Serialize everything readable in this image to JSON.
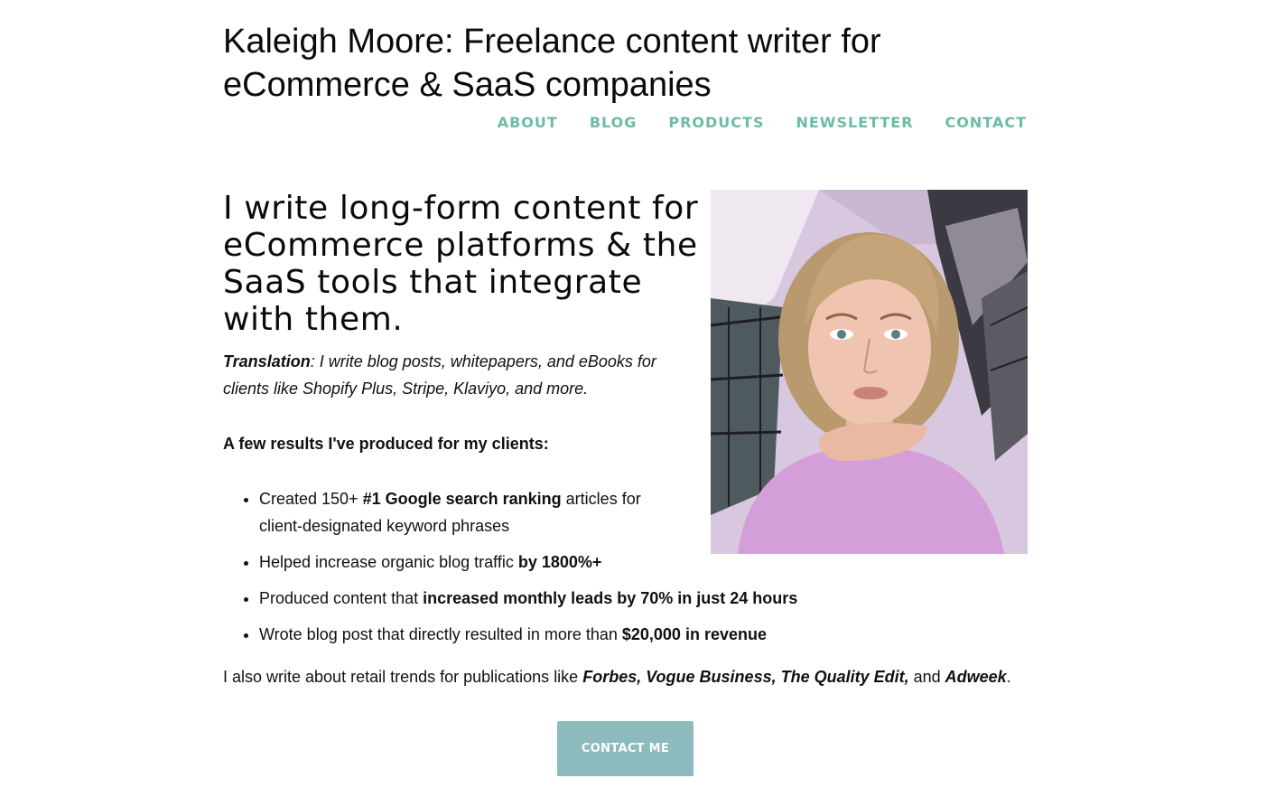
{
  "site": {
    "title": "Kaleigh Moore: Freelance content writer for eCommerce & SaaS companies"
  },
  "nav": {
    "items": [
      {
        "label": "ABOUT"
      },
      {
        "label": "BLOG"
      },
      {
        "label": "PRODUCTS"
      },
      {
        "label": "NEWSLETTER"
      },
      {
        "label": "CONTACT"
      }
    ]
  },
  "hero": {
    "headline": "I write long-form content for eCommerce platforms & the SaaS tools that integrate with them.",
    "translation_label": "Translation",
    "translation_text": ": I write blog posts, whitepapers, and eBooks for clients like Shopify Plus, Stripe, Klaviyo, and more.",
    "photo_alt": "Photo of Kaleigh Moore"
  },
  "results": {
    "heading": "A few results I've produced for my clients:",
    "items": [
      {
        "pre": "Created 150+ ",
        "bold": "#1 Google search ranking",
        "post": " articles for client-designated keyword phrases"
      },
      {
        "pre": "Helped increase organic blog traffic ",
        "bold": "by 1800%+",
        "post": ""
      },
      {
        "pre": "Produced content that ",
        "bold": "increased monthly leads by 70% in just 24 hours",
        "post": ""
      },
      {
        "pre": "Wrote blog post that directly resulted in more than ",
        "bold": "$20,000 in revenue",
        "post": ""
      }
    ]
  },
  "publications": {
    "pre": "I also write about retail trends for publications like ",
    "list": "Forbes, Vogue Business, The Quality Edit,",
    "and": " and ",
    "last": "Adweek",
    "end": "."
  },
  "cta": {
    "label": "CONTACT ME"
  },
  "colors": {
    "nav_accent": "#6bbba6",
    "button_bg": "#8cbabd"
  }
}
